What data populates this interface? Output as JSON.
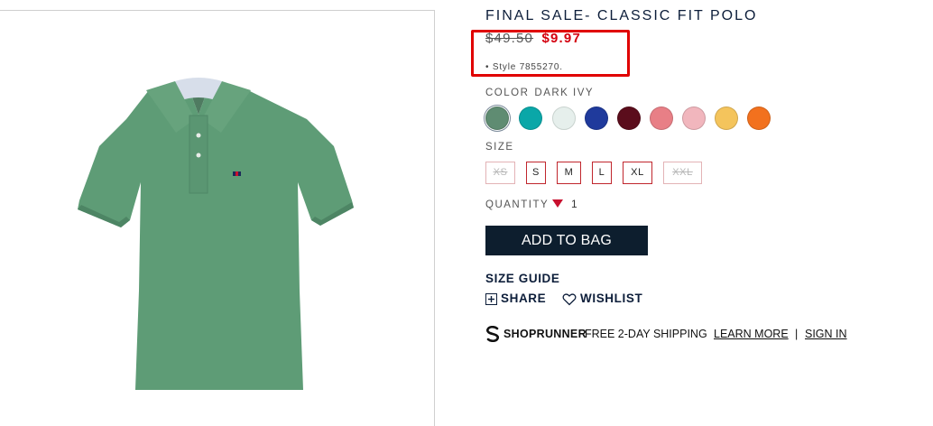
{
  "product": {
    "title": "FINAL SALE- CLASSIC FIT POLO",
    "old_price": "$49.50",
    "new_price": "$9.97",
    "style_line": "• Style 7855270."
  },
  "color": {
    "label": "COLOR",
    "selected": "DARK IVY",
    "swatches": [
      {
        "name": "dark-ivy",
        "hex": "#5f8c72",
        "selected": true
      },
      {
        "name": "teal",
        "hex": "#0aa7a8"
      },
      {
        "name": "pale-mint",
        "hex": "#e6efec"
      },
      {
        "name": "navy-blue",
        "hex": "#1f3a9c"
      },
      {
        "name": "burgundy",
        "hex": "#5b0d1c"
      },
      {
        "name": "coral-pink",
        "hex": "#e87f86"
      },
      {
        "name": "light-pink",
        "hex": "#f1b6bd"
      },
      {
        "name": "gold",
        "hex": "#f4c45c"
      },
      {
        "name": "orange",
        "hex": "#f2711e"
      }
    ]
  },
  "size": {
    "label": "SIZE",
    "options": [
      {
        "label": "XS",
        "available": false
      },
      {
        "label": "S",
        "available": true
      },
      {
        "label": "M",
        "available": true
      },
      {
        "label": "L",
        "available": true
      },
      {
        "label": "XL",
        "available": true
      },
      {
        "label": "XXL",
        "available": false
      }
    ]
  },
  "quantity": {
    "label": "QUANTITY",
    "value": "1"
  },
  "add_to_bag_label": "ADD TO BAG",
  "size_guide_label": "SIZE GUIDE",
  "share_label": "SHARE",
  "wishlist_label": "WISHLIST",
  "shoprunner": {
    "brand": "SHOPRUNNER",
    "text": "FREE 2-DAY SHIPPING",
    "learn_more": "LEARN MORE",
    "separator": "|",
    "sign_in": "SIGN IN"
  },
  "colors": {
    "accent": "#d4000e",
    "navy": "#0d1e3a",
    "button": "#0d1e2e"
  }
}
